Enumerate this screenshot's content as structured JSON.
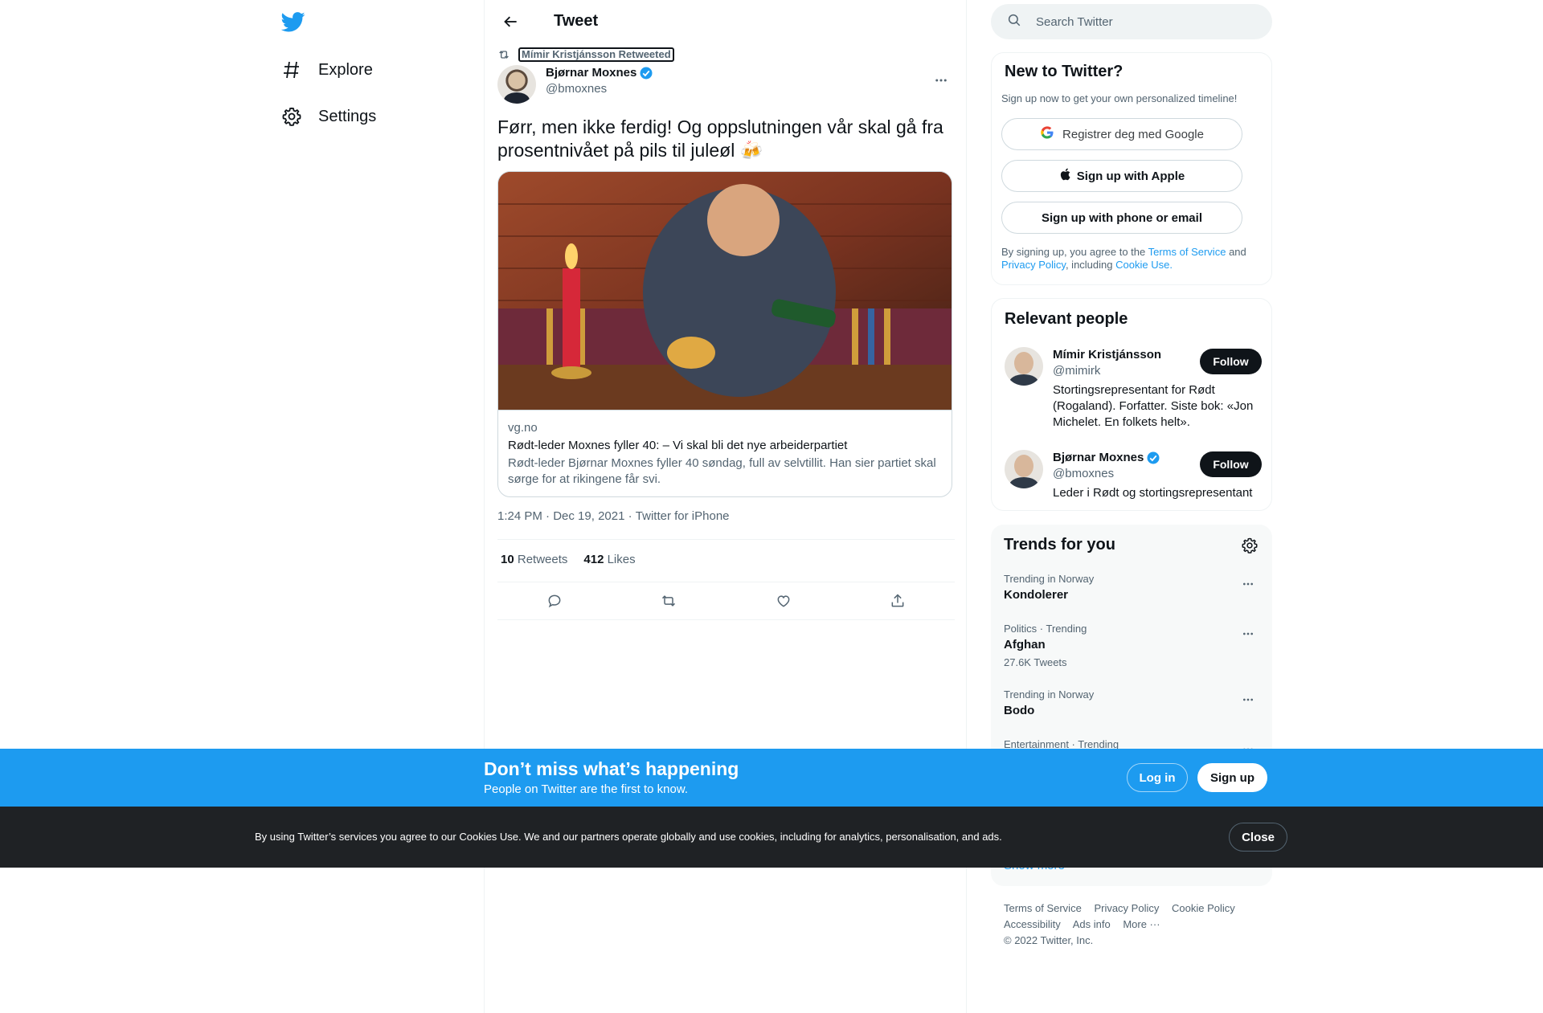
{
  "nav": {
    "explore_label": "Explore",
    "settings_label": "Settings"
  },
  "header": {
    "title": "Tweet"
  },
  "tweet": {
    "retweeted_by": "Mímir Kristjánsson Retweeted",
    "author_name": "Bjørnar Moxnes",
    "author_handle": "@bmoxnes",
    "text": "Førr, men ikke ferdig! Og oppslutningen vår skal gå fra prosentnivået på pils til juleøl 🍻",
    "card": {
      "domain": "vg.no",
      "title": "Rødt-leder Moxnes fyller 40: – Vi skal bli det nye arbeiderpartiet",
      "description": "Rødt-leder Bjørnar Moxnes fyller 40 søndag, full av selvtillit. Han sier partiet skal sørge for at rikingene får svi."
    },
    "time": "1:24 PM",
    "date": "Dec 19, 2021",
    "source": "Twitter for iPhone",
    "retweets_count": "10",
    "retweets_label": "Retweets",
    "likes_count": "412",
    "likes_label": "Likes"
  },
  "search": {
    "placeholder": "Search Twitter"
  },
  "new_to_twitter": {
    "title": "New to Twitter?",
    "subtitle": "Sign up now to get your own personalized timeline!",
    "google_label": "Registrer deg med Google",
    "apple_label": "Sign up with Apple",
    "phone_label": "Sign up with phone or email",
    "legal_prefix": "By signing up, you agree to the",
    "terms_link": "Terms of Service",
    "and_text": "and",
    "privacy_link": "Privacy Policy",
    "including_text": ", including",
    "cookie_link": "Cookie Use."
  },
  "relevant_people": {
    "title": "Relevant people",
    "people": [
      {
        "name": "Mímir Kristjánsson",
        "handle": "@mimirk",
        "bio": "Stortingsrepresentant for Rødt (Rogaland). Forfatter. Siste bok: «Jon Michelet. En folkets helt».",
        "follow_label": "Follow"
      },
      {
        "name": "Bjørnar Moxnes",
        "handle": "@bmoxnes",
        "bio": "Leder i Rødt og stortingsrepresentant",
        "follow_label": "Follow"
      }
    ]
  },
  "trends": {
    "title": "Trends for you",
    "items": [
      {
        "category": "Trending in Norway",
        "name": "Kondolerer",
        "count": ""
      },
      {
        "category": "Politics · Trending",
        "name": "Afghan",
        "count": "27.6K Tweets"
      },
      {
        "category": "Trending in Norway",
        "name": "Bodo",
        "count": ""
      },
      {
        "category": "Entertainment · Trending",
        "name": "",
        "count": ""
      }
    ],
    "show_more": "Show more"
  },
  "footer": {
    "links": [
      "Terms of Service",
      "Privacy Policy",
      "Cookie Policy",
      "Accessibility",
      "Ads info",
      "More ···"
    ],
    "copyright": "© 2022 Twitter, Inc."
  },
  "banner": {
    "title": "Don’t miss what’s happening",
    "subtitle": "People on Twitter are the first to know.",
    "login_label": "Log in",
    "signup_label": "Sign up"
  },
  "cookie_bar": {
    "text": "By using Twitter’s services you agree to our Cookies Use. We and our partners operate globally and use cookies, including for analytics, personalisation, and ads.",
    "close_label": "Close"
  },
  "colors": {
    "brand_blue": "#1d9bf0",
    "text_primary": "#0f1419",
    "text_secondary": "#536471",
    "cookie_bg": "#1f2225"
  }
}
